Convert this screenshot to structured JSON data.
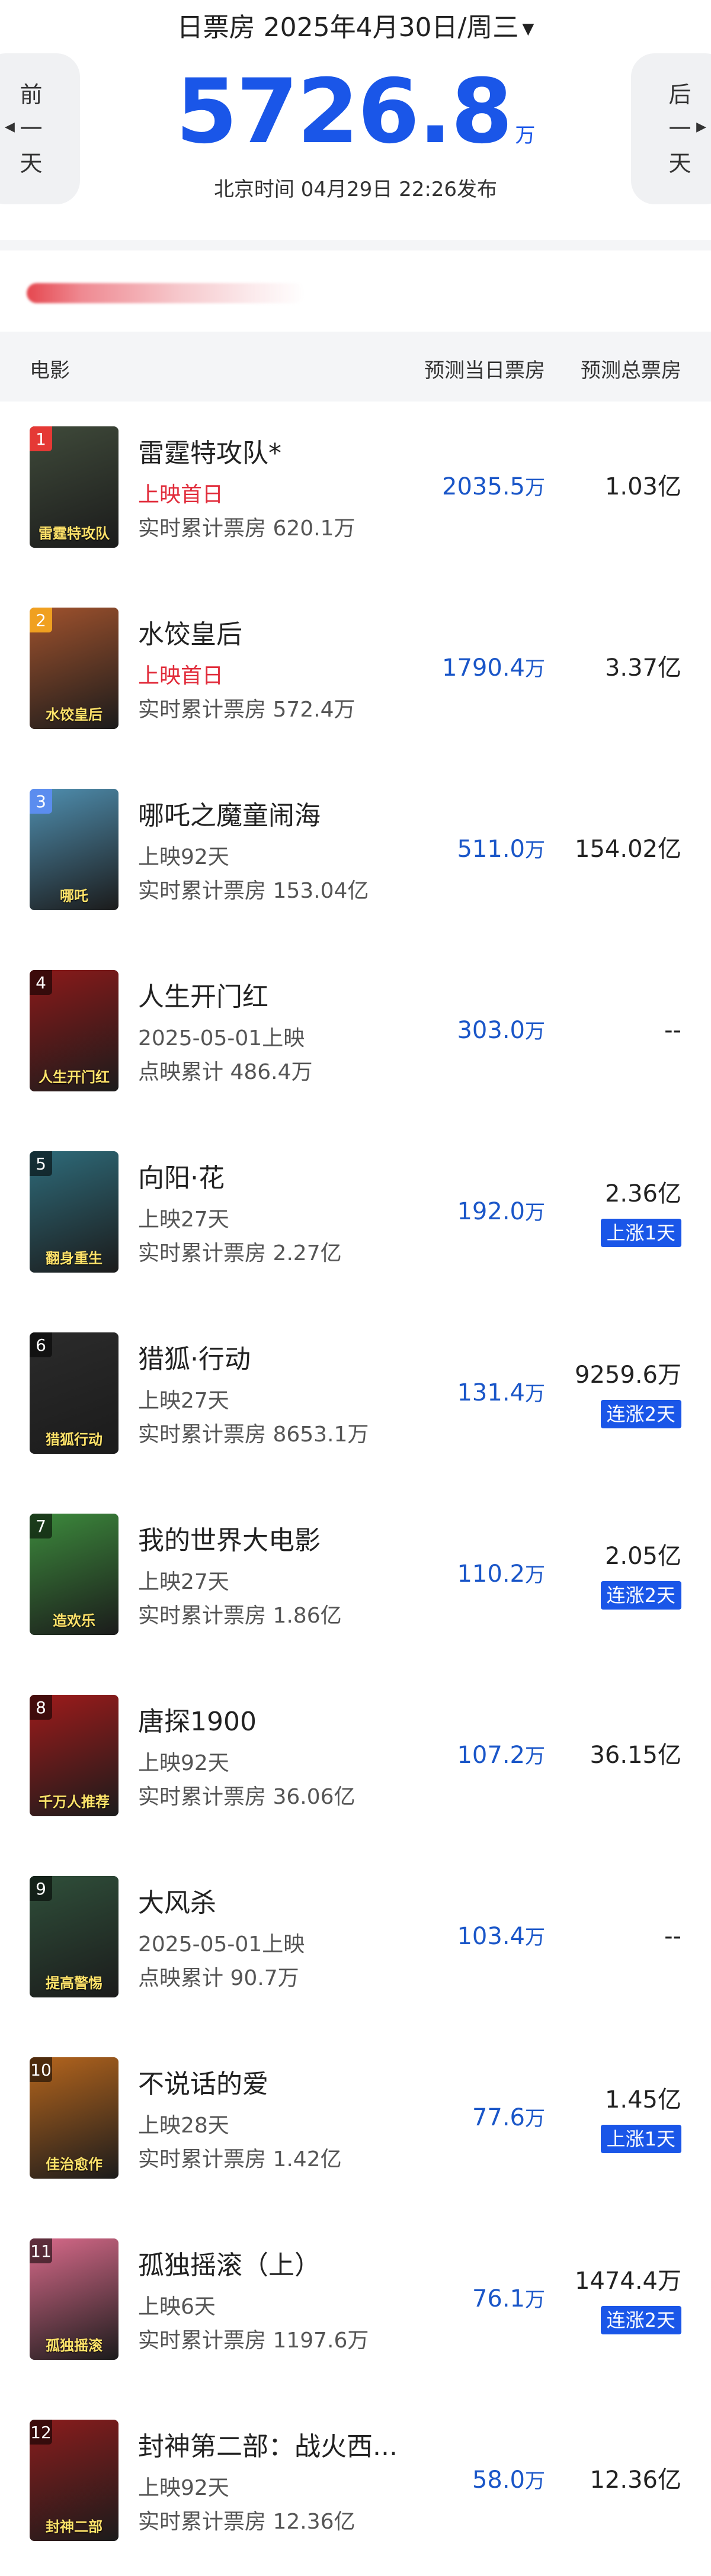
{
  "header": {
    "title": "日票房 2025年4月30日/周三",
    "dropdown_icon": "caret-down-icon",
    "total_value": "5726.8",
    "total_unit": "万",
    "publish_info": "北京时间  04月29日  22:26发布",
    "prev_label": [
      "前",
      "一",
      "天"
    ],
    "next_label": [
      "后",
      "一",
      "天"
    ],
    "accent_color": "#1a56e8"
  },
  "table": {
    "col_film": "电影",
    "col_day": "预测当日票房",
    "col_total": "预测总票房"
  },
  "movies": [
    {
      "rank": "1",
      "name": "雷霆特攻队*",
      "status": "上映首日",
      "status_red": true,
      "sub": "实时累计票房 620.1万",
      "day": "2035.5",
      "day_unit": "万",
      "total": "1.03亿",
      "badge": "",
      "poster_text": "雷霆特攻队",
      "poster_color": "#3f4a3a"
    },
    {
      "rank": "2",
      "name": "水饺皇后",
      "status": "上映首日",
      "status_red": true,
      "sub": "实时累计票房 572.4万",
      "day": "1790.4",
      "day_unit": "万",
      "total": "3.37亿",
      "badge": "",
      "poster_text": "水饺皇后",
      "poster_color": "#a0522d"
    },
    {
      "rank": "3",
      "name": "哪吒之魔童闹海",
      "status": "上映92天",
      "status_red": false,
      "sub": "实时累计票房 153.04亿",
      "day": "511.0",
      "day_unit": "万",
      "total": "154.02亿",
      "badge": "",
      "poster_text": "哪吒",
      "poster_color": "#4f8fb0"
    },
    {
      "rank": "4",
      "name": "人生开门红",
      "status": "2025-05-01上映",
      "status_red": false,
      "sub": "点映累计 486.4万",
      "day": "303.0",
      "day_unit": "万",
      "total": "--",
      "badge": "",
      "poster_text": "人生开门红",
      "poster_color": "#8b1a1a"
    },
    {
      "rank": "5",
      "name": "向阳·花",
      "status": "上映27天",
      "status_red": false,
      "sub": "实时累计票房 2.27亿",
      "day": "192.0",
      "day_unit": "万",
      "total": "2.36亿",
      "badge": "上涨1天",
      "poster_text": "翻身重生",
      "poster_color": "#2e6b7a"
    },
    {
      "rank": "6",
      "name": "猎狐·行动",
      "status": "上映27天",
      "status_red": false,
      "sub": "实时累计票房 8653.1万",
      "day": "131.4",
      "day_unit": "万",
      "total": "9259.6万",
      "badge": "连涨2天",
      "poster_text": "猎狐行动",
      "poster_color": "#2b2b2b"
    },
    {
      "rank": "7",
      "name": "我的世界大电影",
      "status": "上映27天",
      "status_red": false,
      "sub": "实时累计票房 1.86亿",
      "day": "110.2",
      "day_unit": "万",
      "total": "2.05亿",
      "badge": "连涨2天",
      "poster_text": "造欢乐",
      "poster_color": "#3c8a3c"
    },
    {
      "rank": "8",
      "name": "唐探1900",
      "status": "上映92天",
      "status_red": false,
      "sub": "实时累计票房 36.06亿",
      "day": "107.2",
      "day_unit": "万",
      "total": "36.15亿",
      "badge": "",
      "poster_text": "千万人推荐",
      "poster_color": "#9e1b1b"
    },
    {
      "rank": "9",
      "name": "大风杀",
      "status": "2025-05-01上映",
      "status_red": false,
      "sub": "点映累计 90.7万",
      "day": "103.4",
      "day_unit": "万",
      "total": "--",
      "badge": "",
      "poster_text": "提高警惕",
      "poster_color": "#2f4f3a"
    },
    {
      "rank": "10",
      "name": "不说话的爱",
      "status": "上映28天",
      "status_red": false,
      "sub": "实时累计票房 1.42亿",
      "day": "77.6",
      "day_unit": "万",
      "total": "1.45亿",
      "badge": "上涨1天",
      "poster_text": "佳治愈作",
      "poster_color": "#b5651d"
    },
    {
      "rank": "11",
      "name": "孤独摇滚（上）",
      "status": "上映6天",
      "status_red": false,
      "sub": "实时累计票房 1197.6万",
      "day": "76.1",
      "day_unit": "万",
      "total": "1474.4万",
      "badge": "连涨2天",
      "poster_text": "孤独摇滚",
      "poster_color": "#d86a8a"
    },
    {
      "rank": "12",
      "name": "封神第二部：战火西...",
      "status": "上映92天",
      "status_red": false,
      "sub": "实时累计票房 12.36亿",
      "day": "58.0",
      "day_unit": "万",
      "total": "12.36亿",
      "badge": "",
      "poster_text": "封神二部",
      "poster_color": "#8a1c1c"
    }
  ]
}
